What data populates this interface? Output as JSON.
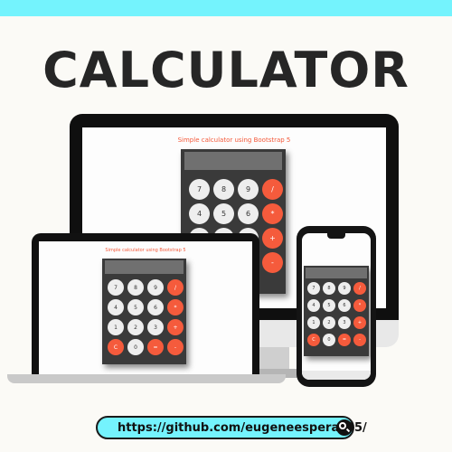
{
  "headline": "CALCULATOR",
  "app": {
    "title": "Simple calculator using Bootstrap 5",
    "keys": [
      {
        "label": "7",
        "kind": "num"
      },
      {
        "label": "8",
        "kind": "num"
      },
      {
        "label": "9",
        "kind": "num"
      },
      {
        "label": "/",
        "kind": "op"
      },
      {
        "label": "4",
        "kind": "num"
      },
      {
        "label": "5",
        "kind": "num"
      },
      {
        "label": "6",
        "kind": "num"
      },
      {
        "label": "*",
        "kind": "op"
      },
      {
        "label": "1",
        "kind": "num"
      },
      {
        "label": "2",
        "kind": "num"
      },
      {
        "label": "3",
        "kind": "num"
      },
      {
        "label": "+",
        "kind": "op"
      },
      {
        "label": "C",
        "kind": "op"
      },
      {
        "label": "0",
        "kind": "num"
      },
      {
        "label": "=",
        "kind": "op"
      },
      {
        "label": "-",
        "kind": "op"
      }
    ]
  },
  "footer": {
    "url": "https://github.com/eugeneesperas05/",
    "search_icon": "search-icon"
  },
  "colors": {
    "accent": "#74f3fd",
    "operator": "#f55b3c",
    "number_key": "#eeeeee",
    "calc_body": "#3a3a3a",
    "display": "#707070"
  }
}
